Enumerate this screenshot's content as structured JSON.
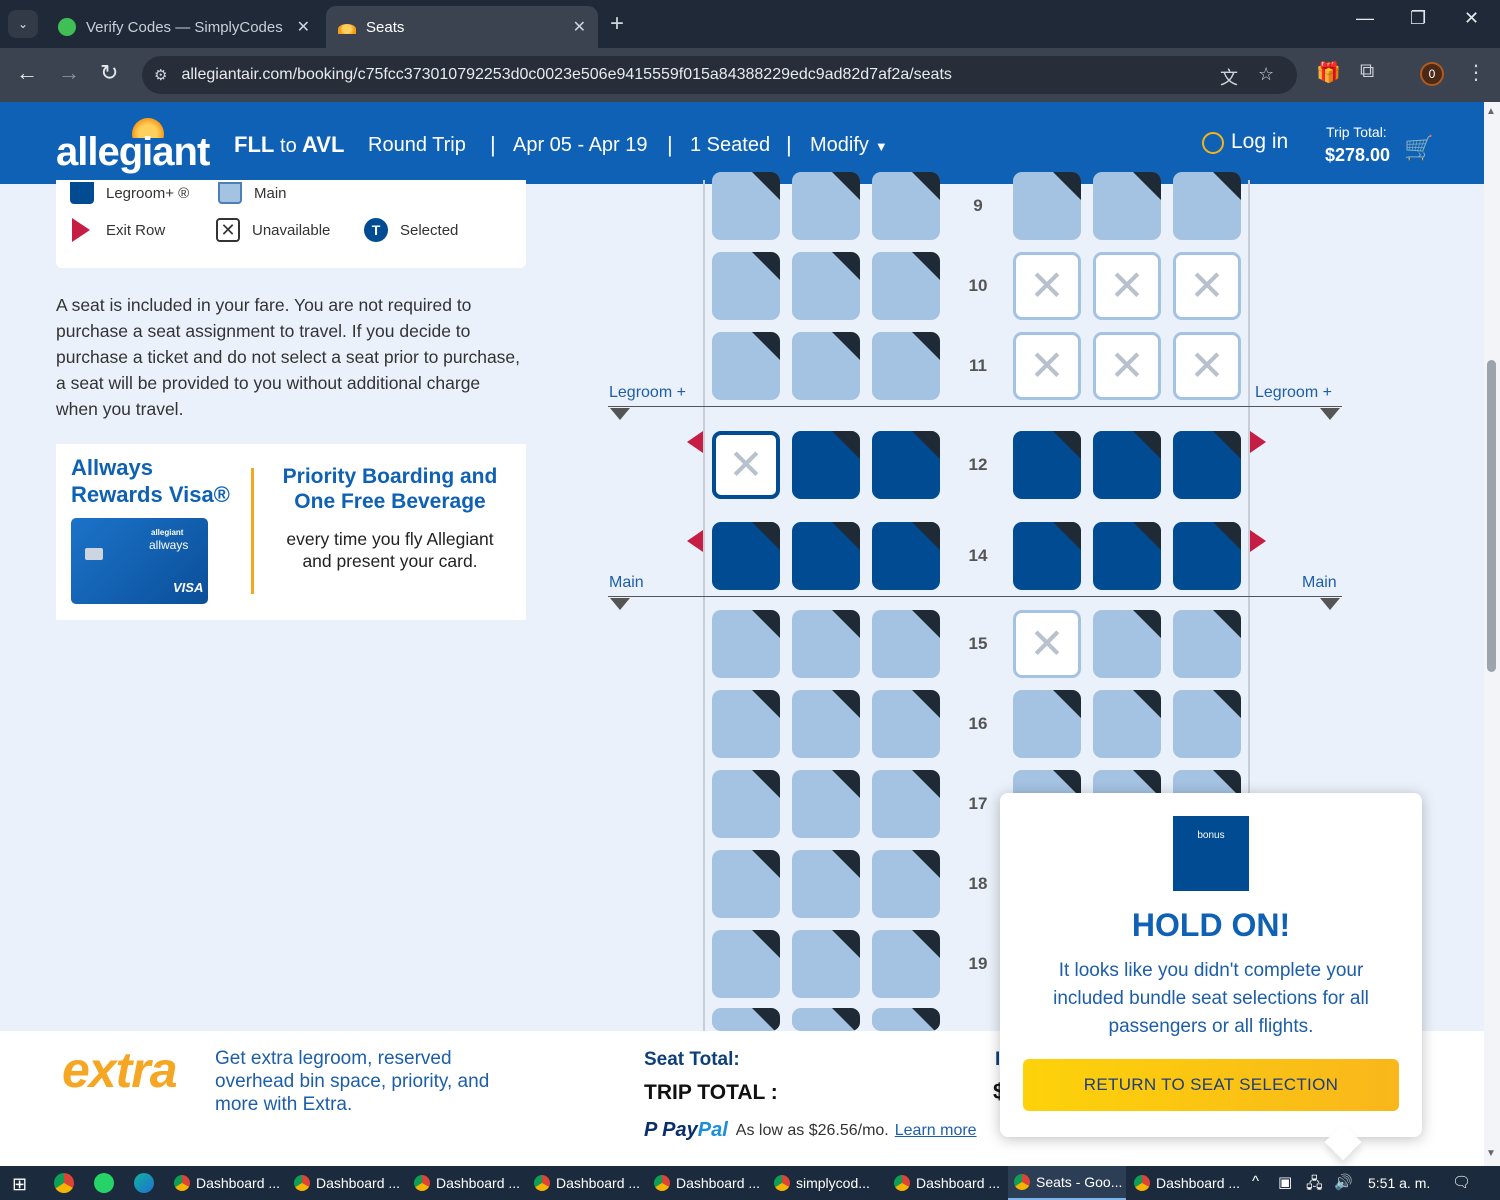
{
  "browser": {
    "tabs": [
      {
        "title": "Verify Codes — SimplyCodes",
        "close": "✕"
      },
      {
        "title": "Seats",
        "close": "✕"
      }
    ],
    "new_tab": "+",
    "controls": {
      "minimize": "—",
      "maximize": "❐",
      "close": "✕"
    },
    "url": "allegiantair.com/booking/c75fcc373010792253d0c0023e506e9415559f015a84388229edc9ad82d7af2a/seats",
    "profile_badge": "0"
  },
  "header": {
    "logo": "allegiant",
    "origin": "FLL",
    "to": "to",
    "destination": "AVL",
    "trip_type": "Round Trip",
    "dates": "Apr 05 - Apr 19",
    "seated": "1 Seated",
    "modify": "Modify",
    "separator": "|",
    "login": "Log in",
    "trip_total_label": "Trip Total:",
    "trip_total_value": "$278.00"
  },
  "legend": {
    "legroom": "Legroom+ ®",
    "main": "Main",
    "exit_row": "Exit Row",
    "unavailable": "Unavailable",
    "selected": "Selected",
    "selected_badge": "T"
  },
  "fare_text": "A seat is included in your fare. You are not required to purchase a seat assignment to travel. If you decide to purchase a ticket and do not select a seat prior to purchase, a seat will be provided to you without additional charge when you travel.",
  "promo": {
    "card_title": "Allways Rewards Visa®",
    "card_brand_small": "allegiant",
    "card_brand": "allways",
    "card_network": "VISA",
    "headline": "Priority Boarding and One Free Beverage",
    "body": "every time you fly Allegiant and present your card."
  },
  "seatmap": {
    "zones": {
      "legroom_left": "Legroom +",
      "legroom_right": "Legroom +",
      "main_left": "Main",
      "main_right": "Main"
    },
    "rows": [
      {
        "num": "9",
        "cls": "main",
        "seats": [
          "o",
          "o",
          "o",
          "o",
          "o",
          "o"
        ]
      },
      {
        "num": "10",
        "cls": "main",
        "seats": [
          "o",
          "o",
          "o",
          "x",
          "x",
          "x"
        ]
      },
      {
        "num": "11",
        "cls": "main",
        "seats": [
          "o",
          "o",
          "o",
          "x",
          "x",
          "x"
        ]
      },
      {
        "num": "12",
        "cls": "lp",
        "seats": [
          "x",
          "o",
          "o",
          "o",
          "o",
          "o"
        ]
      },
      {
        "num": "14",
        "cls": "lp",
        "seats": [
          "o",
          "o",
          "o",
          "o",
          "o",
          "o"
        ]
      },
      {
        "num": "15",
        "cls": "main",
        "seats": [
          "o",
          "o",
          "o",
          "x",
          "o",
          "o"
        ]
      },
      {
        "num": "16",
        "cls": "main",
        "seats": [
          "o",
          "o",
          "o",
          "o",
          "o",
          "o"
        ]
      },
      {
        "num": "17",
        "cls": "main",
        "seats": [
          "o",
          "o",
          "o",
          "o",
          "o",
          "o"
        ]
      },
      {
        "num": "18",
        "cls": "main",
        "seats": [
          "o",
          "o",
          "o",
          "o",
          "o",
          "o"
        ]
      },
      {
        "num": "19",
        "cls": "main",
        "seats": [
          "o",
          "o",
          "o",
          "o",
          "o",
          "o"
        ]
      }
    ],
    "colors": {
      "main": "#a4c2e2",
      "legroom_plus": "#004b92",
      "exit": "#c51d43"
    }
  },
  "bottom": {
    "extra_logo": "extra",
    "extra_text": "Get extra legroom, reserved overhead bin space, priority, and more with Extra.",
    "seat_total_label": "Seat Total:",
    "trip_total_label": "TRIP TOTAL :",
    "paypal_logo_a": "Pay",
    "paypal_logo_b": "Pal",
    "paypal_text": "As low as $26.56/mo.",
    "paypal_link": "Learn more",
    "cut_value": "$",
    "cut_label": "I"
  },
  "modal": {
    "bonus_label": "bonus",
    "title": "HOLD ON!",
    "message": "It looks like you didn't complete your included bundle seat selections for all passengers or all flights.",
    "button": "RETURN TO SEAT SELECTION"
  },
  "taskbar": {
    "apps": [
      "Dashboard ...",
      "Dashboard ...",
      "Dashboard ...",
      "Dashboard ...",
      "Dashboard ...",
      "simplycod...",
      "Dashboard ...",
      "Seats - Goo...",
      "Dashboard ..."
    ],
    "time": "5:51 a. m."
  }
}
